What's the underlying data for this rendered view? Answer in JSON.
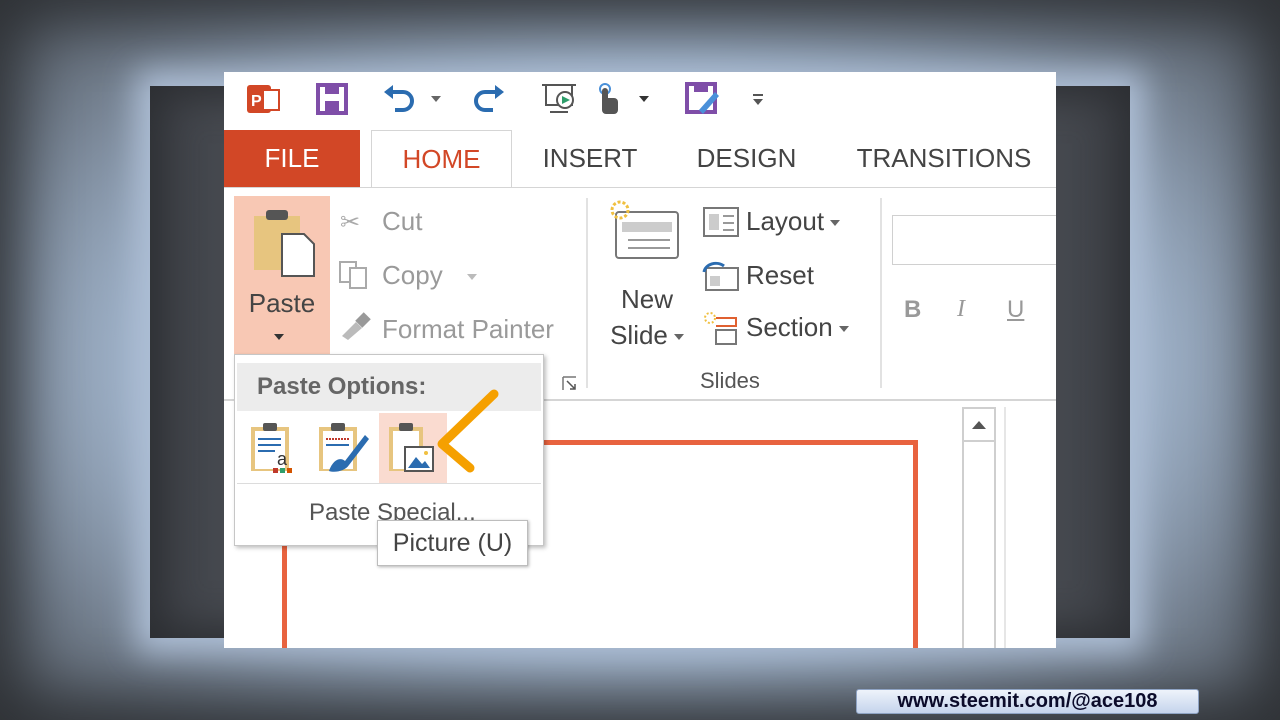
{
  "qat": {
    "icons": [
      "powerpoint-logo-icon",
      "save-icon",
      "undo-icon",
      "undo-dropdown-icon",
      "redo-icon",
      "start-from-beginning-icon",
      "touch-mode-icon",
      "touch-dropdown-icon",
      "save-as-icon",
      "customize-qat-icon"
    ]
  },
  "tabs": [
    {
      "label": "FILE"
    },
    {
      "label": "HOME",
      "active": true
    },
    {
      "label": "INSERT"
    },
    {
      "label": "DESIGN"
    },
    {
      "label": "TRANSITIONS"
    }
  ],
  "clipboard": {
    "paste": "Paste",
    "cut": "Cut",
    "copy": "Copy",
    "format_painter": "Format Painter"
  },
  "slides": {
    "new_slide_line1": "New",
    "new_slide_line2": "Slide",
    "layout": "Layout",
    "reset": "Reset",
    "section": "Section",
    "group_label": "Slides"
  },
  "font": {
    "bold": "B",
    "italic": "I",
    "underline": "U"
  },
  "paste_menu": {
    "header": "Paste Options:",
    "options": [
      "Use Destination Theme",
      "Keep Source Formatting",
      "Picture"
    ],
    "paste_special": "Paste Special..."
  },
  "tooltip": "Picture (U)",
  "colors": {
    "accent": "#d24726",
    "annotation": "#f5a000",
    "slide_border": "#e8633f"
  },
  "watermark": "www.steemit.com/@ace108"
}
